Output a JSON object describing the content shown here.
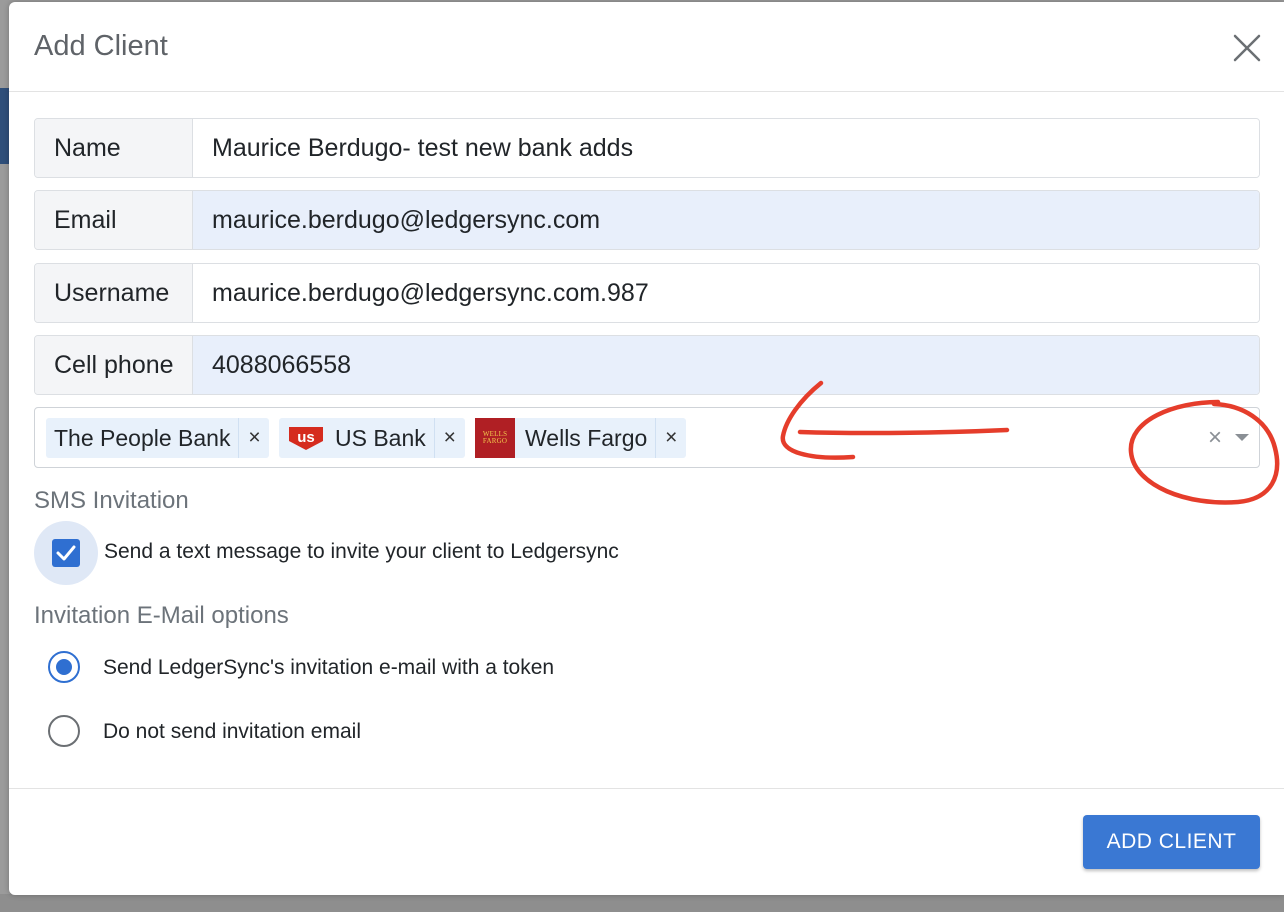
{
  "modal": {
    "title": "Add Client"
  },
  "form": {
    "name": {
      "label": "Name",
      "value": "Maurice Berdugo- test new bank adds"
    },
    "email": {
      "label": "Email",
      "value": "maurice.berdugo@ledgersync.com"
    },
    "username": {
      "label": "Username",
      "value": "maurice.berdugo@ledgersync.com.987"
    },
    "cell_phone": {
      "label": "Cell phone",
      "value": "4088066558"
    }
  },
  "banks": {
    "selected": [
      {
        "label": "The People Bank",
        "remove": "×"
      },
      {
        "label": "US Bank",
        "logo_text": "us",
        "remove": "×"
      },
      {
        "label": "Wells Fargo",
        "logo_text_1": "WELLS",
        "logo_text_2": "FARGO",
        "remove": "×"
      }
    ],
    "clear_icon": "×"
  },
  "sms": {
    "section_title": "SMS Invitation",
    "checkbox_label": "Send a text message to invite your client to Ledgersync",
    "checked": true
  },
  "email_options": {
    "section_title": "Invitation E-Mail options",
    "options": [
      {
        "label": "Send LedgerSync's invitation e-mail with a token",
        "selected": true
      },
      {
        "label": "Do not send invitation email",
        "selected": false
      }
    ]
  },
  "footer": {
    "submit_label": "ADD CLIENT"
  },
  "colors": {
    "primary": "#3a78d3",
    "autofill_bg": "#e8effb",
    "annotation_red": "#e53d2b",
    "wells_fargo_red": "#b01f24",
    "us_bank_red": "#d52b1e"
  }
}
